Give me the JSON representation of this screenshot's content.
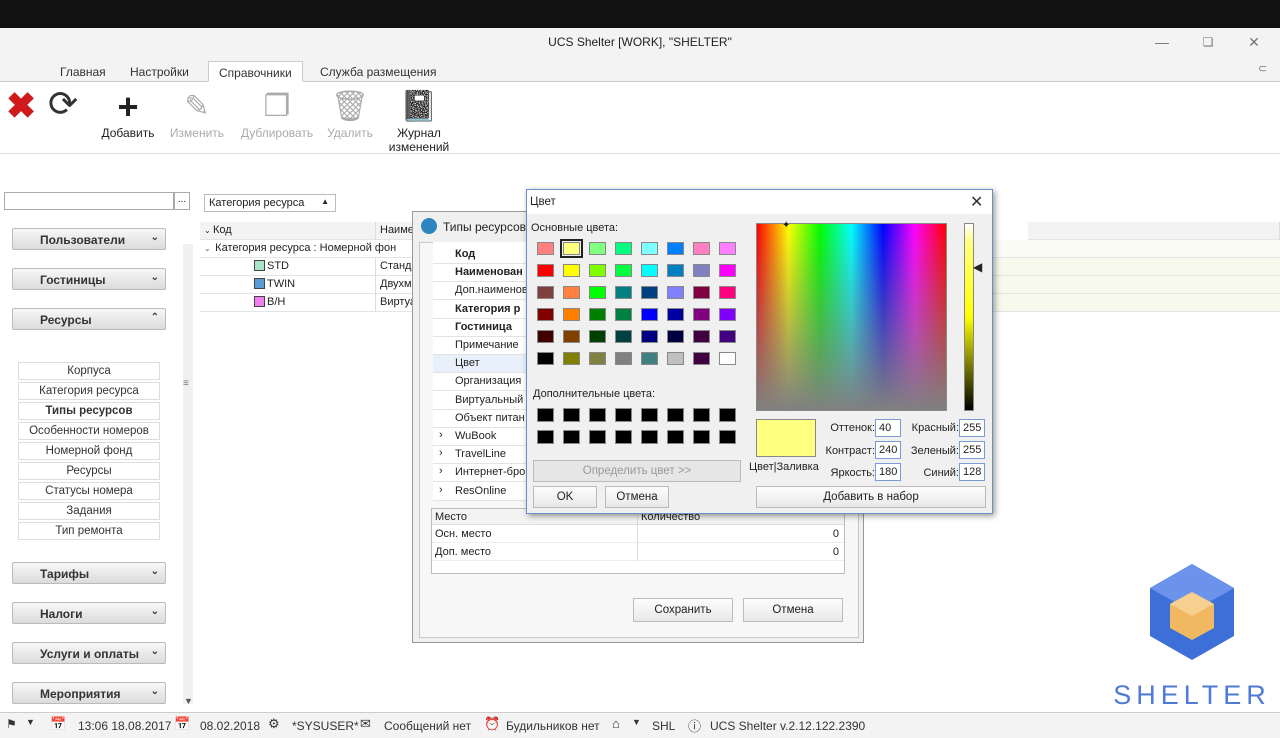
{
  "window": {
    "title": "UCS Shelter [WORK], \"SHELTER\""
  },
  "menu_tabs": [
    "Главная",
    "Настройки",
    "Справочники",
    "Служба размещения"
  ],
  "ribbon": {
    "add": "Добавить",
    "edit": "Изменить",
    "duplicate": "Дублировать",
    "delete": "Удалить",
    "journal_line1": "Журнал",
    "journal_line2": "изменений"
  },
  "sidebar": {
    "sections": [
      "Пользователи",
      "Гостиницы",
      "Ресурсы",
      "Тарифы",
      "Налоги",
      "Услуги и оплаты",
      "Мероприятия"
    ],
    "resource_items": [
      "Корпуса",
      "Категория ресурса",
      "Типы ресурсов",
      "Особенности номеров",
      "Номерной фонд",
      "Ресурсы",
      "Статусы номера",
      "Задания",
      "Тип ремонта"
    ]
  },
  "grid": {
    "category_dropdown": "Категория ресурса",
    "col_code": "Код",
    "col_name": "Наиме",
    "group_row": "Категория ресурса : Номерной фон",
    "rows": [
      {
        "code": "STD",
        "name": "Станд",
        "color": "#a8e6c8"
      },
      {
        "code": "TWIN",
        "name": "Двухм",
        "color": "#5b9bd5"
      },
      {
        "code": "B/H",
        "name": "Виртуа",
        "color": "#f080f0"
      }
    ]
  },
  "types_dialog": {
    "title": "Типы ресурсов",
    "props": [
      "Код",
      "Наименован",
      "Доп.наименов",
      "Категория р",
      "Гостиница",
      "Примечание",
      "Цвет",
      "Организация",
      "Виртуальный",
      "Объект питан",
      "WuBook",
      "TravelLine",
      "Интернет-бро",
      "ResOnline"
    ],
    "places_header": [
      "Место",
      "Количество"
    ],
    "places": [
      {
        "place": "Осн. место",
        "qty": "0"
      },
      {
        "place": "Доп. место",
        "qty": "0"
      }
    ],
    "save": "Сохранить",
    "cancel": "Отмена"
  },
  "color_dialog": {
    "title": "Цвет",
    "basic_label": "Основные цвета:",
    "custom_label": "Дополнительные цвета:",
    "define_button": "Определить цвет >>",
    "ok": "OK",
    "cancel": "Отмена",
    "add_button": "Добавить в набор",
    "preview_label": "Цвет|Заливка",
    "hue_label": "Оттенок:",
    "hue": "40",
    "sat_label": "Контраст:",
    "sat": "240",
    "lum_label": "Яркость:",
    "lum": "180",
    "red_label": "Красный:",
    "red": "255",
    "green_label": "Зеленый:",
    "green": "255",
    "blue_label": "Синий:",
    "blue": "128",
    "selected_color": "#ffff80",
    "basic_colors": [
      "#ff8080",
      "#ffff80",
      "#80ff80",
      "#00ff80",
      "#80ffff",
      "#0080ff",
      "#ff80c0",
      "#ff80ff",
      "#ff0000",
      "#ffff00",
      "#80ff00",
      "#00ff40",
      "#00ffff",
      "#0080c0",
      "#8080c0",
      "#ff00ff",
      "#804040",
      "#ff8040",
      "#00ff00",
      "#008080",
      "#004080",
      "#8080ff",
      "#800040",
      "#ff0080",
      "#800000",
      "#ff8000",
      "#008000",
      "#008040",
      "#0000ff",
      "#0000a0",
      "#800080",
      "#8000ff",
      "#400000",
      "#804000",
      "#004000",
      "#004040",
      "#000080",
      "#000040",
      "#400040",
      "#400080",
      "#000000",
      "#808000",
      "#808040",
      "#808080",
      "#408080",
      "#c0c0c0",
      "#400040",
      "#ffffff"
    ]
  },
  "status": {
    "date1": "13:06 18.08.2017",
    "date2": "08.02.2018",
    "user": "*SYSUSER*",
    "messages": "Сообщений нет",
    "alarms": "Будильников нет",
    "hotel": "SHL",
    "version": "UCS Shelter v.2.12.122.2390"
  },
  "watermark": "SHELTER"
}
